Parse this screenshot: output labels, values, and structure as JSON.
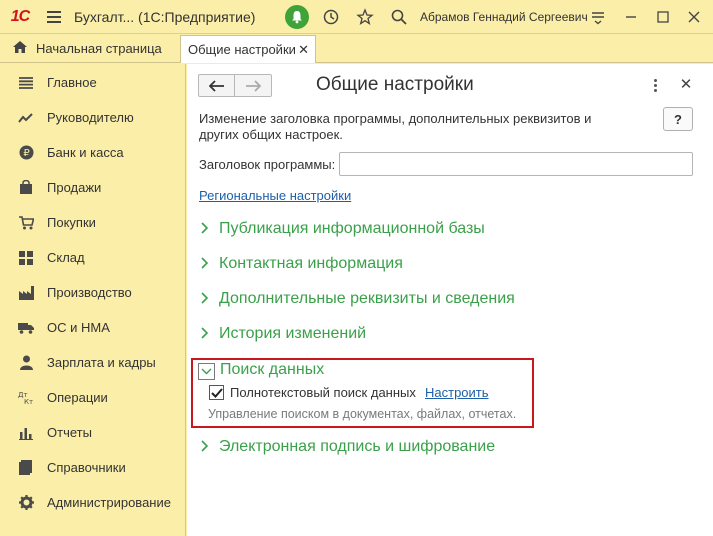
{
  "titlebar": {
    "logo_text": "1С",
    "app_title": "Бухгалт... (1С:Предприятие)",
    "user_name": "Абрамов Геннадий Сергеевич",
    "icons": [
      "hamburger-icon",
      "bell-icon",
      "history-icon",
      "star-icon",
      "search-icon",
      "settings-icon",
      "minimize-icon",
      "maximize-icon",
      "close-icon"
    ],
    "bell_color": "#3fa33a"
  },
  "tabs": {
    "home_label": "Начальная страница",
    "active_label": "Общие настройки"
  },
  "sidebar": {
    "items": [
      {
        "label": "Главное",
        "icon": "menu-list-icon"
      },
      {
        "label": "Руководителю",
        "icon": "trend-icon"
      },
      {
        "label": "Банк и касса",
        "icon": "coin-icon"
      },
      {
        "label": "Продажи",
        "icon": "bag-icon"
      },
      {
        "label": "Покупки",
        "icon": "cart-icon"
      },
      {
        "label": "Склад",
        "icon": "grid-icon"
      },
      {
        "label": "Производство",
        "icon": "factory-icon"
      },
      {
        "label": "ОС и НМА",
        "icon": "truck-icon"
      },
      {
        "label": "Зарплата и кадры",
        "icon": "person-icon"
      },
      {
        "label": "Операции",
        "icon": "dt-kt-icon"
      },
      {
        "label": "Отчеты",
        "icon": "bar-chart-icon"
      },
      {
        "label": "Справочники",
        "icon": "book-icon"
      },
      {
        "label": "Администрирование",
        "icon": "gear-icon"
      }
    ]
  },
  "form": {
    "title": "Общие настройки",
    "description": "Изменение заголовка программы, дополнительных реквизитов и других общих настроек.",
    "help_label": "?",
    "field_label": "Заголовок программы:",
    "field_value": "",
    "regional_link": "Региональные настройки",
    "sections": [
      "Публикация информационной базы",
      "Контактная информация",
      "Дополнительные реквизиты и сведения",
      "История изменений"
    ],
    "expanded_section": {
      "label": "Поиск данных",
      "checkbox_label": "Полнотекстовый поиск данных",
      "checkbox_checked": true,
      "setup_link": "Настроить",
      "hint": "Управление поиском в документах, файлах, отчетах."
    },
    "last_section": "Электронная подпись и шифрование",
    "accent_color": "#3aa14a",
    "highlight_color": "#c8181e"
  }
}
